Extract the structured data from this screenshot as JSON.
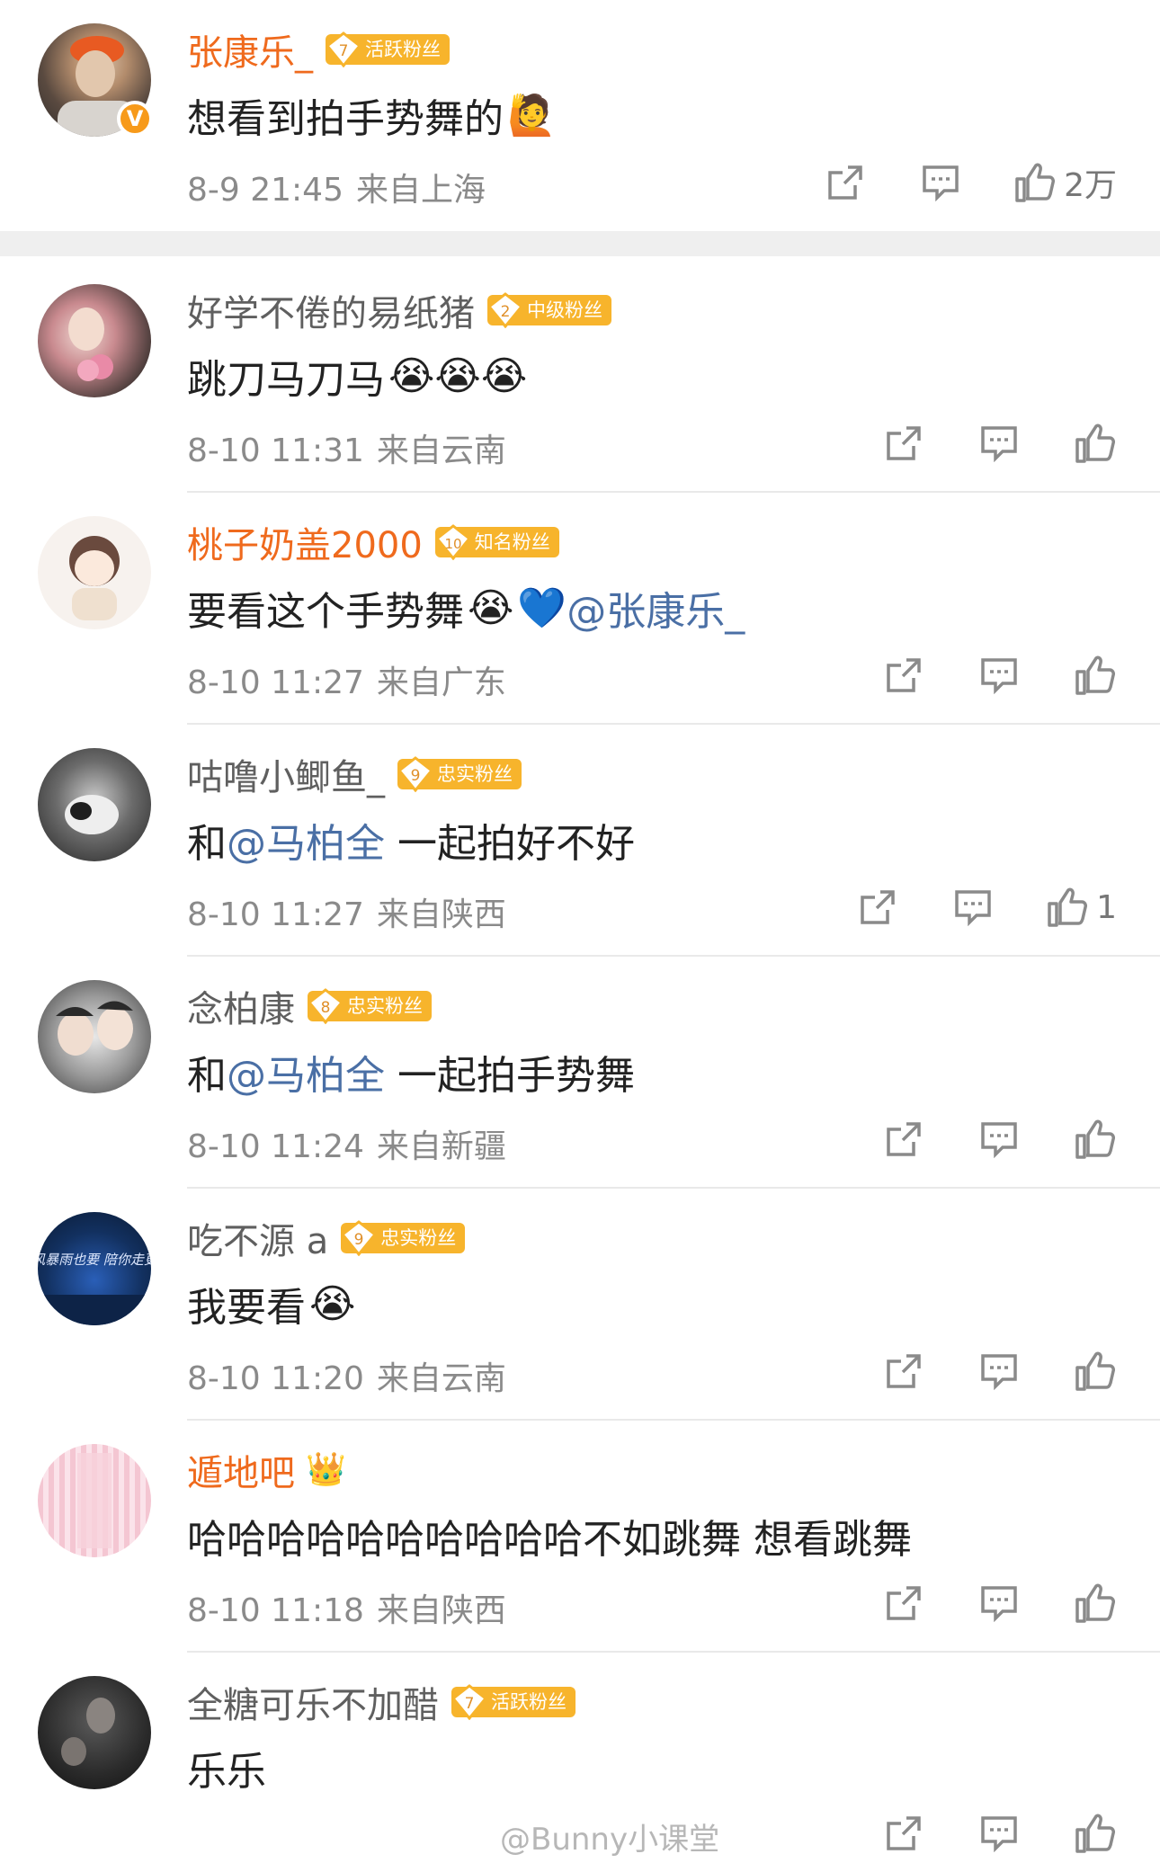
{
  "icons": {
    "share": "share-icon",
    "comment": "comment-icon",
    "like": "thumbs-up-icon"
  },
  "colors": {
    "orange_name": "#ef6a1d",
    "gray_name": "#5f5f5f",
    "mention": "#4a6fa5",
    "badge": "#f7b42c"
  },
  "comments": [
    {
      "name": "张康乐_",
      "level": "7",
      "badge": "活跃粉丝",
      "text": "想看到拍手势舞的",
      "time": "8-9 21:45",
      "location": "来自上海",
      "likes": "2万"
    },
    {
      "name": "好学不倦的易纸猪",
      "level": "2",
      "badge": "中级粉丝",
      "text": "跳刀马刀马",
      "time": "8-10 11:31",
      "location": "来自云南",
      "likes": ""
    },
    {
      "name": "桃子奶盖2000",
      "level": "10",
      "badge": "知名粉丝",
      "text": "要看这个手势舞",
      "mention": "@张康乐_",
      "time": "8-10 11:27",
      "location": "来自广东",
      "likes": ""
    },
    {
      "name": "咕噜小鲫鱼_",
      "level": "9",
      "badge": "忠实粉丝",
      "text_pre": "和",
      "mention": "@马柏全",
      "text_post": " 一起拍好不好",
      "time": "8-10 11:27",
      "location": "来自陕西",
      "likes": "1"
    },
    {
      "name": "念柏康",
      "level": "8",
      "badge": "忠实粉丝",
      "text_pre": "和",
      "mention": "@马柏全",
      "text_post": " 一起拍手势舞",
      "time": "8-10 11:24",
      "location": "来自新疆",
      "likes": ""
    },
    {
      "name": "吃不源 a",
      "level": "9",
      "badge": "忠实粉丝",
      "text": "我要看",
      "avatar_text": "狂风暴雨也要 陪你走更远",
      "time": "8-10 11:20",
      "location": "来自云南",
      "likes": ""
    },
    {
      "name": "遁地吧",
      "text": "哈哈哈哈哈哈哈哈哈哈不如跳舞 想看跳舞",
      "time": "8-10 11:18",
      "location": "来自陕西",
      "likes": ""
    },
    {
      "name": "全糖可乐不加醋",
      "level": "7",
      "badge": "活跃粉丝",
      "text": "乐乐",
      "time": "",
      "location": "",
      "likes": ""
    }
  ],
  "watermark": "@Bunny小课堂"
}
